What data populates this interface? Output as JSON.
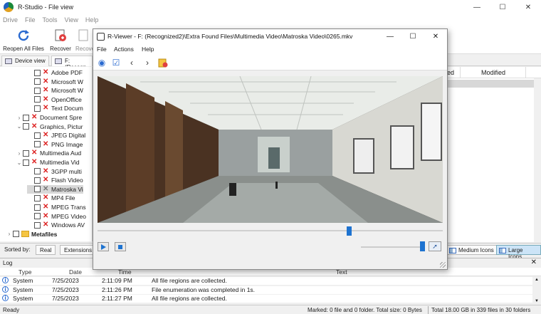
{
  "app": {
    "title": "R-Studio - File view",
    "menu": [
      "Drive",
      "File",
      "Tools",
      "View",
      "Help"
    ]
  },
  "toolbar": {
    "reopen_label": "Reopen All Files",
    "recover_label": "Recover",
    "recover_marked_label": "Recove"
  },
  "tabs": {
    "device_view": "Device view",
    "file_tab": "F: (Recogn"
  },
  "tree": [
    {
      "label": "Adobe PDF",
      "indent": 3,
      "mark": "x"
    },
    {
      "label": "Microsoft W",
      "indent": 3,
      "mark": "x"
    },
    {
      "label": "Microsoft W",
      "indent": 3,
      "mark": "x"
    },
    {
      "label": "OpenOffice",
      "indent": 3,
      "mark": "x"
    },
    {
      "label": "Text Docum",
      "indent": 3,
      "mark": "x"
    },
    {
      "label": "Document Spre",
      "indent": 2,
      "mark": "x",
      "chevron": "›"
    },
    {
      "label": "Graphics, Pictur",
      "indent": 2,
      "mark": "x",
      "chevron": "⌄"
    },
    {
      "label": "JPEG Digital",
      "indent": 3,
      "mark": "x"
    },
    {
      "label": "PNG Image",
      "indent": 3,
      "mark": "x"
    },
    {
      "label": "Multimedia Aud",
      "indent": 2,
      "mark": "x",
      "chevron": "›"
    },
    {
      "label": "Multimedia Vid",
      "indent": 2,
      "mark": "x",
      "chevron": "⌄"
    },
    {
      "label": "3GPP multi",
      "indent": 3,
      "mark": "x"
    },
    {
      "label": "Flash Video",
      "indent": 3,
      "mark": "x"
    },
    {
      "label": "Matroska Vi",
      "indent": 3,
      "mark": "grey",
      "selected": true
    },
    {
      "label": "MP4 File",
      "indent": 3,
      "mark": "x"
    },
    {
      "label": "MPEG Trans",
      "indent": 3,
      "mark": "x"
    },
    {
      "label": "MPEG Video",
      "indent": 3,
      "mark": "x"
    },
    {
      "label": "Windows AV",
      "indent": 3,
      "mark": "x"
    },
    {
      "label": "Metafiles",
      "indent": 0,
      "mark": "folder",
      "chevron": "›",
      "bold": true
    }
  ],
  "list": {
    "col_ed": "ed",
    "col_modified": "Modified"
  },
  "sortbar": {
    "label": "Sorted by:",
    "real": "Real",
    "extensions": "Extensions",
    "medium_icons": "Medium Icons",
    "large_icons": "Large Icons"
  },
  "log": {
    "title": "Log",
    "headers": {
      "type": "Type",
      "date": "Date",
      "time": "Time",
      "text": "Text"
    },
    "rows": [
      {
        "type": "System",
        "date": "7/25/2023",
        "time": "2:11:09 PM",
        "text": "All file regions are collected."
      },
      {
        "type": "System",
        "date": "7/25/2023",
        "time": "2:11:26 PM",
        "text": "File enumeration was completed in 1s."
      },
      {
        "type": "System",
        "date": "7/25/2023",
        "time": "2:11:27 PM",
        "text": "All file regions are collected."
      }
    ]
  },
  "status": {
    "ready": "Ready",
    "marked": "Marked: 0 file and 0 folder. Total size: 0 Bytes",
    "total": "Total 18.00 GB in 339 files in 30 folders"
  },
  "viewer": {
    "title": "R-Viewer - F: (Recognized2)\\Extra Found Files\\Multimedia Video\\Matroska Video\\0265.mkv",
    "menu": {
      "file": "File",
      "actions": "Actions",
      "help": "Help"
    },
    "seek_position": 0.735,
    "volume_level": 1.0
  },
  "colors": {
    "accent": "#1e73d0",
    "error_mark": "#dd2222"
  }
}
